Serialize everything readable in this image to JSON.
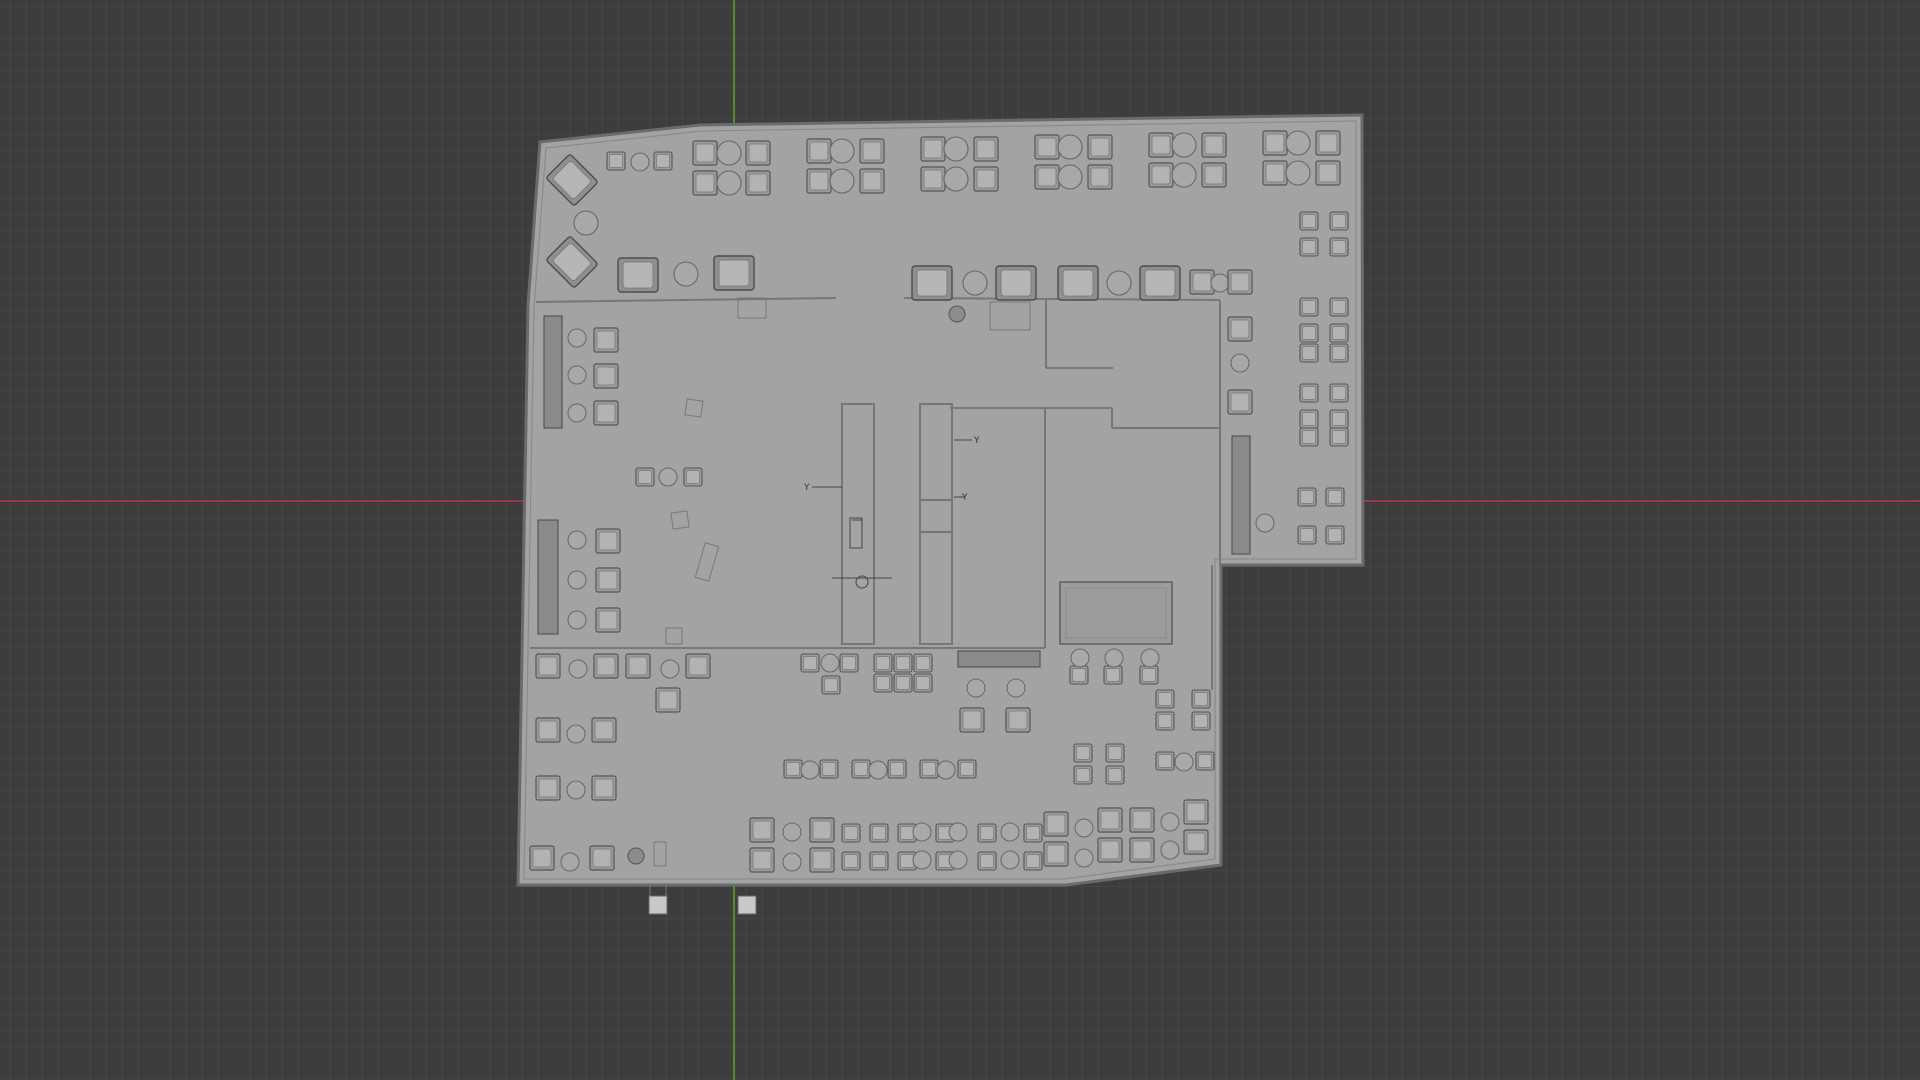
{
  "viewport": {
    "background": "#3d3d3d",
    "x_axis_color": "#9a3a48",
    "y_axis_color": "#5b8a2c",
    "model_fill": "#a3a3a3",
    "model_edge": "#6b6b6b"
  },
  "floorplan": {
    "labels": {
      "dim_1": "Y",
      "dim_2": "Y",
      "dim_3": "Y"
    }
  }
}
